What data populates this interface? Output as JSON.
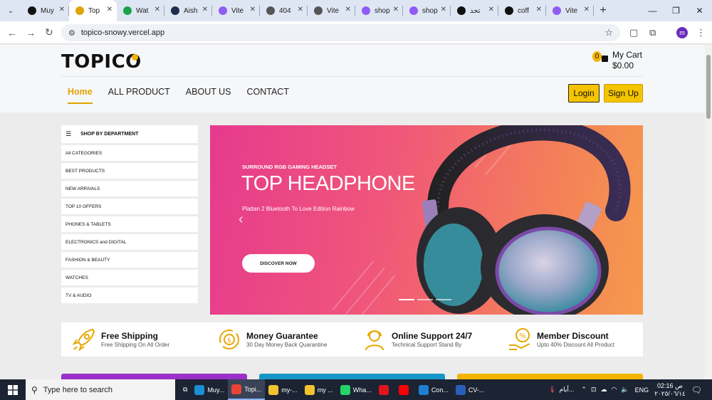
{
  "browser": {
    "tabs": [
      {
        "title": "Muy",
        "icon": "github-icon",
        "color": "#111111",
        "active": false
      },
      {
        "title": "Top",
        "icon": "mail-icon",
        "color": "#e0a300",
        "active": true
      },
      {
        "title": "Wat",
        "icon": "check-circle-icon",
        "color": "#1aa34a",
        "active": false
      },
      {
        "title": "Aish",
        "icon": "react-icon",
        "color": "#1f2d4d",
        "active": false
      },
      {
        "title": "Vite",
        "icon": "vite-icon",
        "color": "#8f5cf6",
        "active": false
      },
      {
        "title": "404",
        "icon": "globe-icon",
        "color": "#555555",
        "active": false
      },
      {
        "title": "Vite",
        "icon": "globe-icon",
        "color": "#555555",
        "active": false
      },
      {
        "title": "shop",
        "icon": "vite-icon",
        "color": "#8f5cf6",
        "active": false
      },
      {
        "title": "shop",
        "icon": "vite-icon",
        "color": "#8f5cf6",
        "active": false
      },
      {
        "title": "تحد",
        "icon": "openai-icon",
        "color": "#111111",
        "active": false
      },
      {
        "title": "coff",
        "icon": "vercel-icon",
        "color": "#111111",
        "active": false
      },
      {
        "title": "Vite",
        "icon": "vite-icon",
        "color": "#8f5cf6",
        "active": false
      }
    ],
    "url": "topico-snowy.vercel.app",
    "profile_initial": "m"
  },
  "site": {
    "logo": "TOPICO",
    "cart": {
      "count": "0",
      "label": "My Cart",
      "total": "$0.00"
    },
    "nav": [
      {
        "label": "Home",
        "active": true
      },
      {
        "label": "ALL PRODUCT",
        "active": false
      },
      {
        "label": "ABOUT US",
        "active": false
      },
      {
        "label": "CONTACT",
        "active": false
      }
    ],
    "login_label": "Login",
    "signup_label": "Sign Up"
  },
  "sidebar": {
    "title": "SHOP BY DEPARTMENT",
    "items": [
      "All CATEGORIES",
      "BEST PRODUCTS",
      "NEW ARRIVALS",
      "TOP 10 OFFERS",
      "PHONES & TABLETS",
      "ELECTRONICS and DIGITAL",
      "FASHION & BEAUTY",
      "WATCHES",
      "TV & AUDIO"
    ]
  },
  "banner": {
    "subtitle": "SURROUND RGB GAMING HEADSET",
    "title": "TOP HEADPHONE",
    "description": "Plattan 2 Bluetooth To Love Edition Rainbow",
    "button": "DISCOVER NOW",
    "slides": 3,
    "current_slide": 1
  },
  "features": [
    {
      "title": "Free Shipping",
      "subtitle": "Free Shipping On All Order",
      "icon": "rocket-icon"
    },
    {
      "title": "Money Guarantee",
      "subtitle": "30 Day Money Back Quarantine",
      "icon": "money-cycle-icon"
    },
    {
      "title": "Online Support 24/7",
      "subtitle": "Technical Support Stand By",
      "icon": "support-agent-icon"
    },
    {
      "title": "Member Discount",
      "subtitle": "Upto 40% Discount All Product",
      "icon": "discount-hand-icon"
    }
  ],
  "promo_colors": [
    "#9b2fc9",
    "#1796c9",
    "#f5b301"
  ],
  "taskbar": {
    "search_placeholder": "Type here to search",
    "items": [
      {
        "label": "Muy...",
        "icon": "edge-icon",
        "color": "#1b8fd6",
        "active": false
      },
      {
        "label": "Topi...",
        "icon": "chrome-icon",
        "color": "#e84335",
        "active": true
      },
      {
        "label": "my-...",
        "icon": "folder-icon",
        "color": "#f2c230",
        "active": false
      },
      {
        "label": "my ...",
        "icon": "folder-icon",
        "color": "#f2c230",
        "active": false
      },
      {
        "label": "Wha...",
        "icon": "whatsapp-icon",
        "color": "#25d366",
        "active": false
      },
      {
        "label": "",
        "icon": "opera-icon",
        "color": "#e1141e",
        "active": false
      },
      {
        "label": "",
        "icon": "youtube-icon",
        "color": "#ff0000",
        "active": false
      },
      {
        "label": "Con...",
        "icon": "vscode-icon",
        "color": "#1f7fd2",
        "active": false
      },
      {
        "label": "CV-...",
        "icon": "word-icon",
        "color": "#2b5fb7",
        "active": false
      }
    ],
    "weather": "أيام...",
    "lang": "ENG",
    "time": "02:16 ص",
    "date": "٢٠٢٥/٠٦/١٤"
  }
}
